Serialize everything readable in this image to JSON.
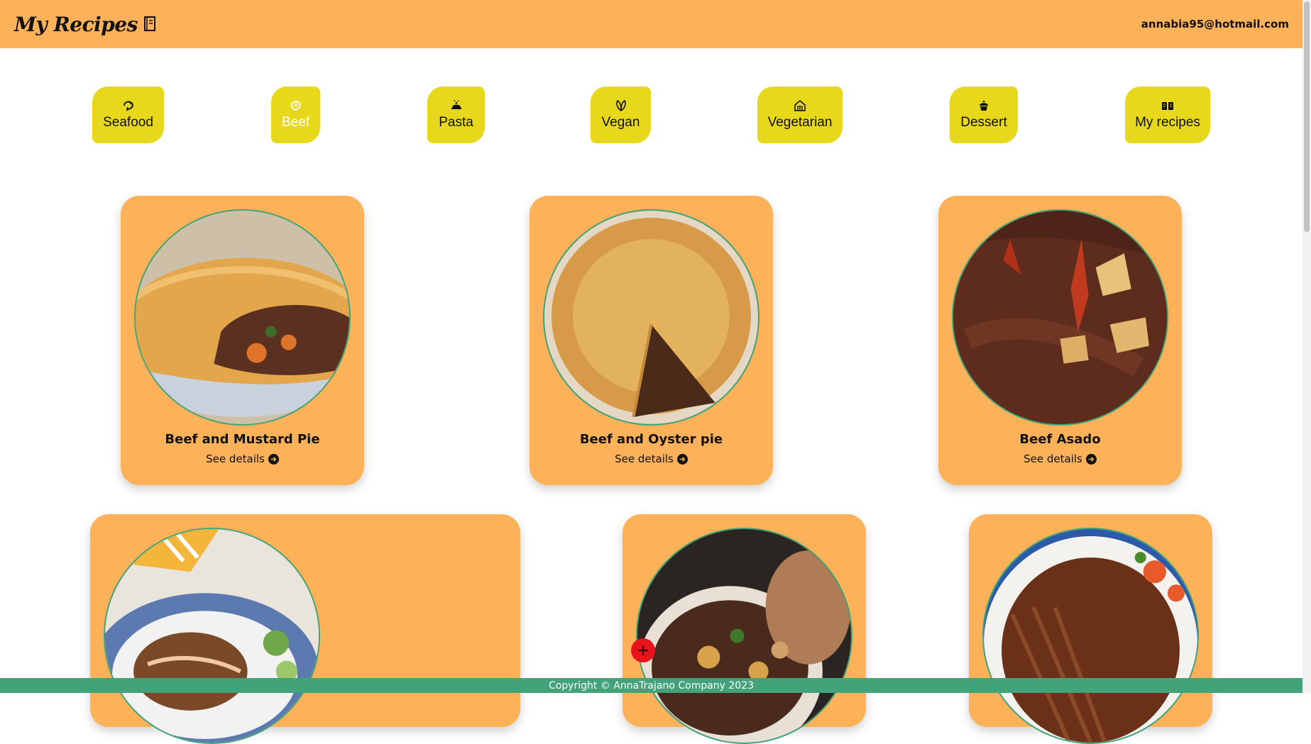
{
  "header": {
    "title": "My Recipes",
    "title_icon": "notebook-icon",
    "user_email": "annabia95@hotmail.com"
  },
  "categories": [
    {
      "label": "Seafood",
      "icon": "shrimp-icon",
      "active": false
    },
    {
      "label": "Beef",
      "icon": "steak-icon",
      "active": true
    },
    {
      "label": "Pasta",
      "icon": "cloche-icon",
      "active": false
    },
    {
      "label": "Vegan",
      "icon": "leaf-icon",
      "active": false
    },
    {
      "label": "Vegetarian",
      "icon": "greenhouse-icon",
      "active": false
    },
    {
      "label": "Dessert",
      "icon": "cupcake-icon",
      "active": false
    },
    {
      "label": "My recipes",
      "icon": "open-book-icon",
      "active": false
    }
  ],
  "recipes": [
    {
      "title": "Beef and Mustard Pie",
      "link_label": "See details"
    },
    {
      "title": "Beef and Oyster pie",
      "link_label": "See details"
    },
    {
      "title": "Beef Asado",
      "link_label": "See details"
    },
    {
      "title": "",
      "link_label": ""
    },
    {
      "title": "",
      "link_label": ""
    },
    {
      "title": "",
      "link_label": ""
    }
  ],
  "fab": {
    "icon": "plus-icon"
  },
  "footer": {
    "copyright": "Copyright © AnnaTrajano Company 2023"
  },
  "colors": {
    "header_bg": "#fdb25a",
    "category_bg": "#e8d81c",
    "card_bg": "#fdb25a",
    "image_border": "#3ea479",
    "footer_bg": "#42a27a",
    "fab_bg": "#e8131b"
  }
}
